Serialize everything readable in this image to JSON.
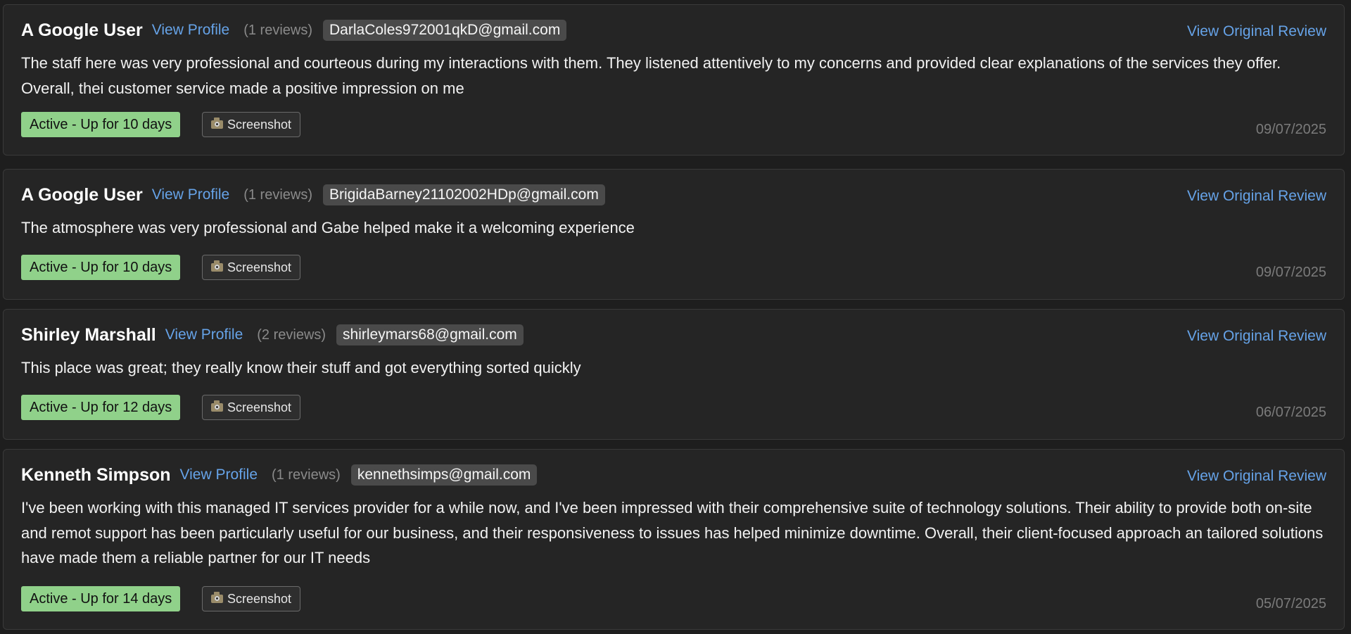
{
  "labels": {
    "view_profile": "View Profile",
    "view_original": "View Original Review",
    "screenshot": "Screenshot"
  },
  "reviews": [
    {
      "author": "A Google User",
      "review_count": "(1 reviews)",
      "email": "DarlaColes972001qkD@gmail.com",
      "text": "The staff here was very professional and courteous during my interactions with them. They listened attentively to my concerns and provided clear explanations of the services they offer. Overall, thei customer service made a positive impression on me",
      "status": "Active - Up for 10 days",
      "date": "09/07/2025"
    },
    {
      "author": "A Google User",
      "review_count": "(1 reviews)",
      "email": "BrigidaBarney21102002HDp@gmail.com",
      "text": "The atmosphere was very professional and Gabe helped make it a welcoming experience",
      "status": "Active - Up for 10 days",
      "date": "09/07/2025"
    },
    {
      "author": "Shirley Marshall",
      "review_count": "(2 reviews)",
      "email": "shirleymars68@gmail.com",
      "text": "This place was great; they really know their stuff and got everything sorted quickly",
      "status": "Active - Up for 12 days",
      "date": "06/07/2025"
    },
    {
      "author": "Kenneth Simpson",
      "review_count": "(1 reviews)",
      "email": "kennethsimps@gmail.com",
      "text": "I've been working with this managed IT services provider for a while now, and I've been impressed with their comprehensive suite of technology solutions. Their ability to provide both on-site and remot support has been particularly useful for our business, and their responsiveness to issues has helped minimize downtime. Overall, their client-focused approach an tailored solutions have made them a reliable partner for our IT needs",
      "status": "Active - Up for 14 days",
      "date": "05/07/2025"
    }
  ],
  "colors": {
    "background": "#1e1e1e",
    "card": "#252525",
    "link": "#66a3e8",
    "status_badge": "#90d18a",
    "email_chip": "#4a4a4a"
  }
}
